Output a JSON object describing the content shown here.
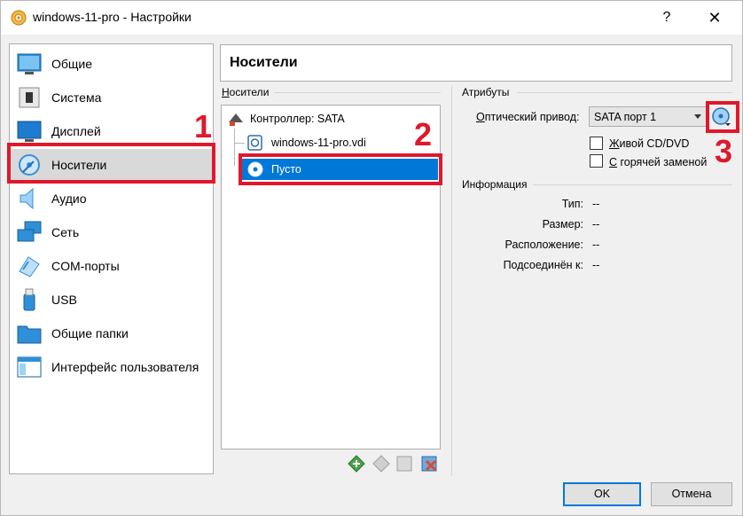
{
  "window": {
    "title": "windows-11-pro - Настройки",
    "help": "?",
    "close": "✕"
  },
  "sidebar": {
    "items": [
      {
        "label": "Общие",
        "icon": "general-icon"
      },
      {
        "label": "Система",
        "icon": "system-icon"
      },
      {
        "label": "Дисплей",
        "icon": "display-icon"
      },
      {
        "label": "Носители",
        "icon": "storage-icon",
        "selected": true
      },
      {
        "label": "Аудио",
        "icon": "audio-icon"
      },
      {
        "label": "Сеть",
        "icon": "network-icon"
      },
      {
        "label": "COM-порты",
        "icon": "serial-ports-icon"
      },
      {
        "label": "USB",
        "icon": "usb-icon"
      },
      {
        "label": "Общие папки",
        "icon": "shared-folders-icon"
      },
      {
        "label": "Интерфейс пользователя",
        "icon": "user-interface-icon"
      }
    ]
  },
  "annotations": {
    "n1": "1",
    "n2": "2",
    "n3": "3",
    "color": "#e0182b"
  },
  "page": {
    "title": "Носители"
  },
  "storage": {
    "label": "Носители",
    "tree": {
      "controller": "Контроллер: SATA",
      "items": [
        "windows-11-pro.vdi",
        "Пусто"
      ]
    }
  },
  "attributes": {
    "label": "Атрибуты",
    "optical_drive_label": "Оптический привод:",
    "optical_drive_value": "SATA порт 1",
    "live_cd": "Живой CD/DVD",
    "live_cd_mnemonic": "Ж",
    "live_cd_rest": "ивой CD/DVD",
    "hot_plug_mnemonic": "С",
    "hot_plug_rest": " горячей заменой"
  },
  "info": {
    "label": "Информация",
    "rows": [
      {
        "label": "Тип:",
        "value": "--"
      },
      {
        "label": "Размер:",
        "value": "--"
      },
      {
        "label": "Расположение:",
        "value": "--"
      },
      {
        "label": "Подсоединён к:",
        "value": "--"
      }
    ]
  },
  "buttons": {
    "ok": "OK",
    "cancel": "Отмена"
  },
  "colors": {
    "selection": "#0078d7",
    "accent": "#e0182b"
  }
}
